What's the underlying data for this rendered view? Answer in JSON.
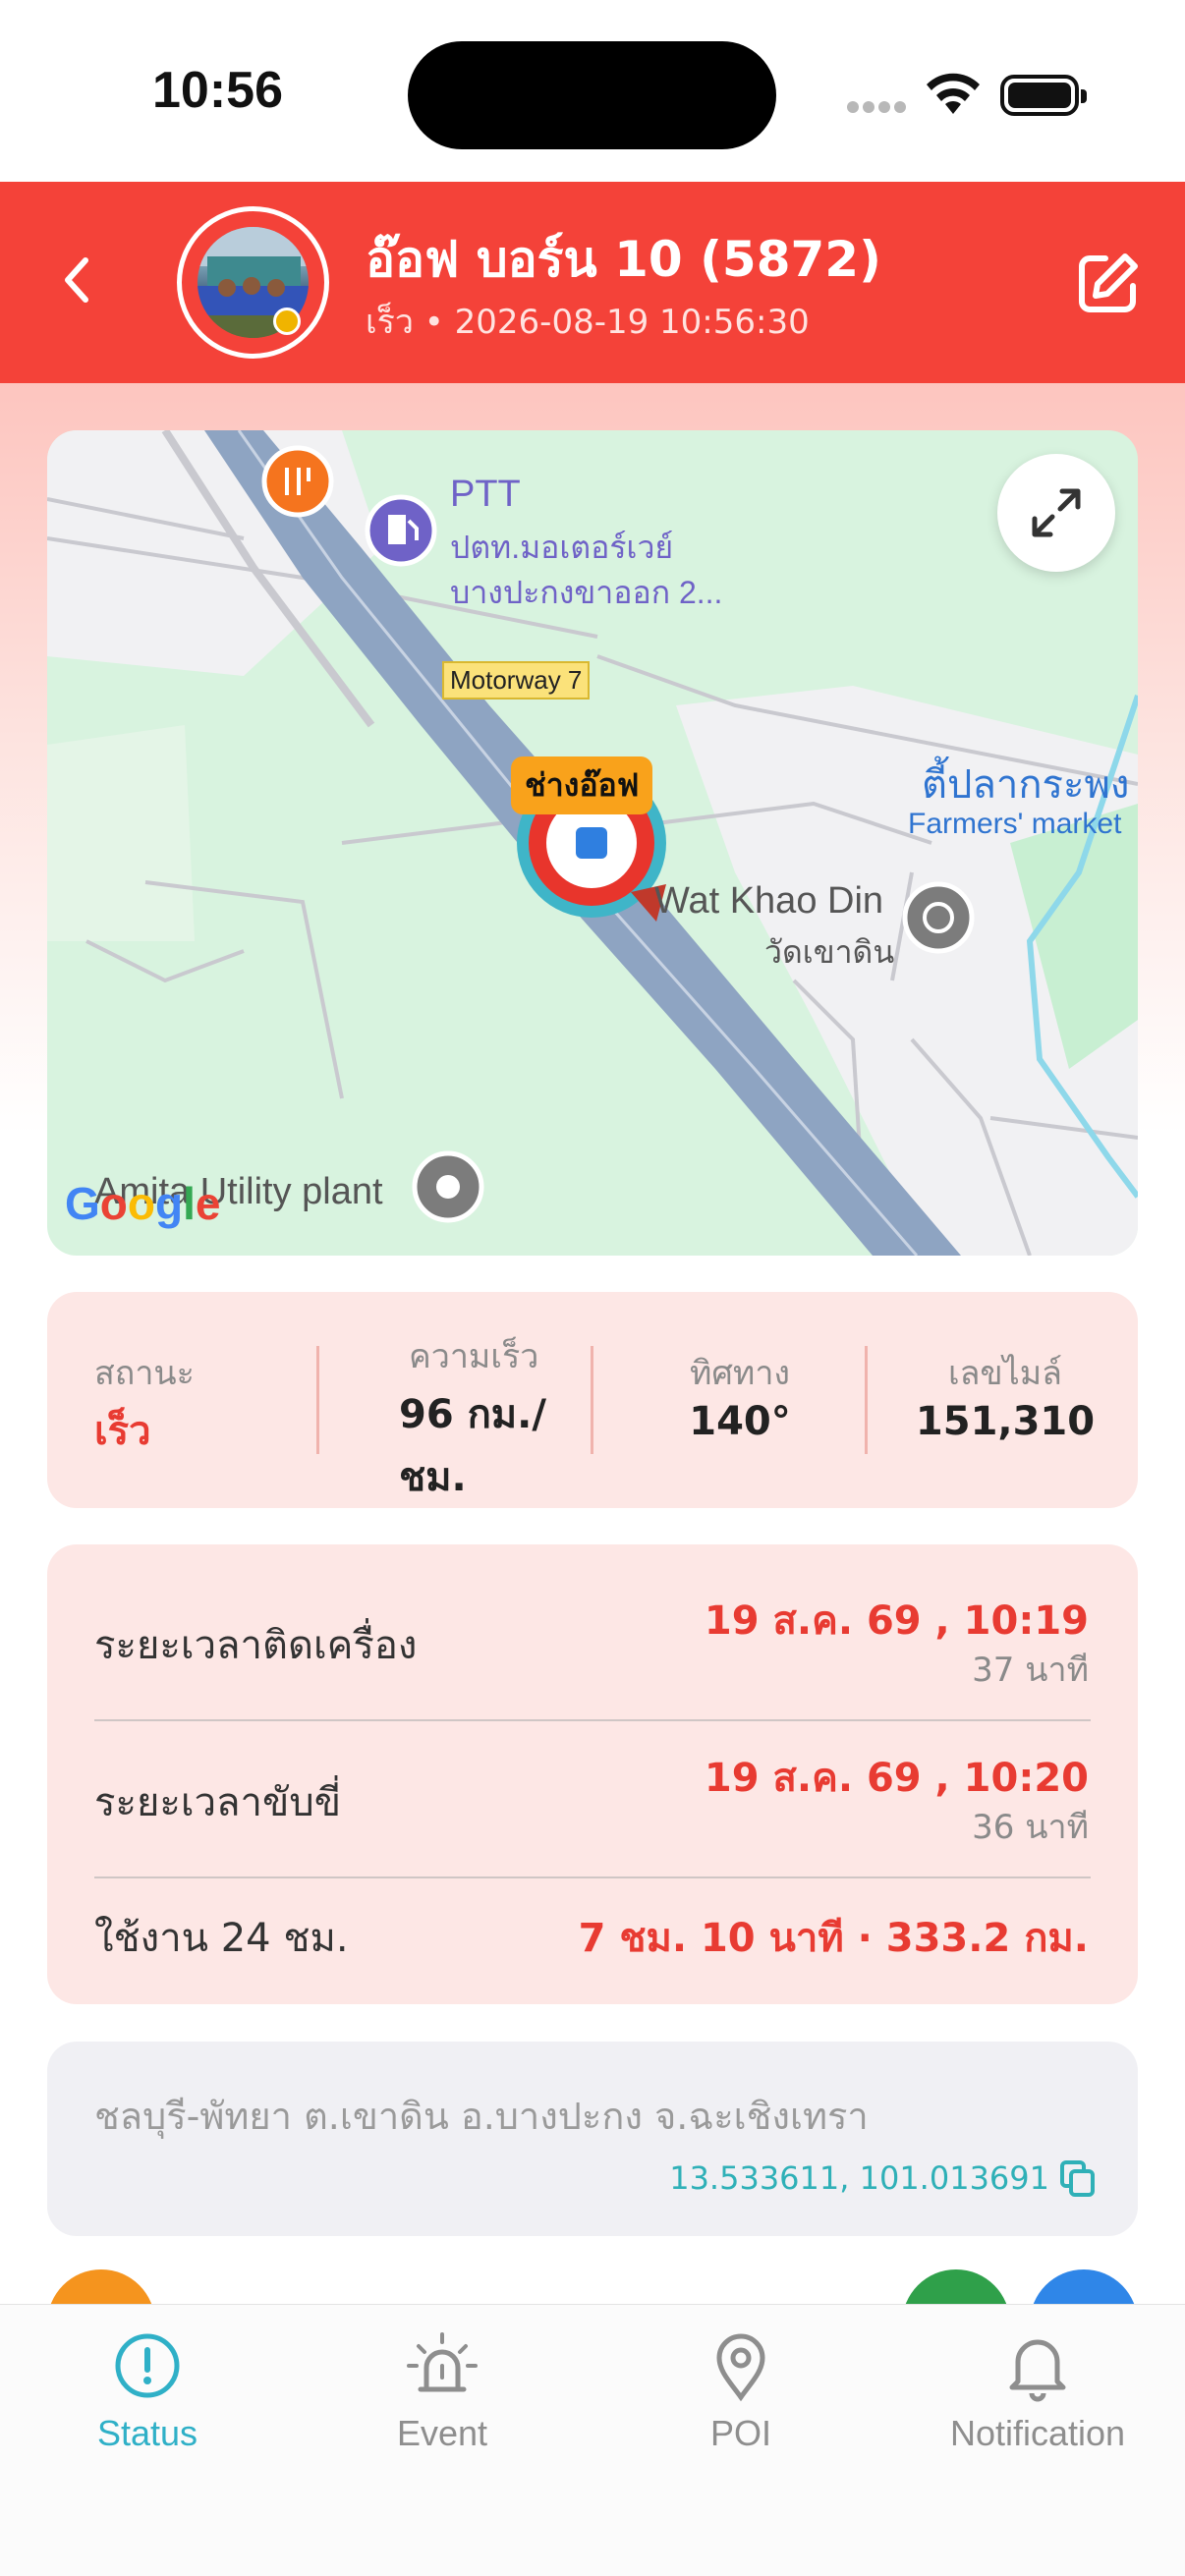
{
  "status_bar": {
    "time": "10:56"
  },
  "header": {
    "title": "อ๊อฟ บอร์น 10 (5872)",
    "subtitle": "เร็ว • 2026-08-19 10:56:30",
    "accent_color": "#f44239"
  },
  "map": {
    "poi_ptt_title": "PTT",
    "poi_ptt_line1": "ปตท.มอเตอร์เวย์",
    "poi_ptt_line2": "บางปะกงขาออก 2...",
    "road_label": "Motorway 7",
    "vehicle_label": "ช่างอ๊อฟ",
    "market_th": "ตี้ปลากระพง",
    "market_en": "Farmers' market",
    "temple_en": "Wat Khao Din",
    "temple_th": "วัดเขาดิน",
    "utility": "Amita Utility plant",
    "provider": "Google"
  },
  "stats": {
    "status_label": "สถานะ",
    "status_value": "เร็ว",
    "speed_label": "ความเร็ว",
    "speed_value_line1": "96 กม./",
    "speed_value_line2": "ชม.",
    "direction_label": "ทิศทาง",
    "direction_value": "140°",
    "odometer_label": "เลขไมล์",
    "odometer_value": "151,310"
  },
  "times": {
    "engine_label": "ระยะเวลาติดเครื่อง",
    "engine_value": "19 ส.ค. 69 , 10:19",
    "engine_sub": "37 นาที",
    "drive_label": "ระยะเวลาขับขี่",
    "drive_value": "19 ส.ค. 69 , 10:20",
    "drive_sub": "36 นาที",
    "usage_label": "ใช้งาน 24 ชม.",
    "usage_value": "7 ชม. 10 นาที · 333.2 กม."
  },
  "address": {
    "text": "ชลบุรี-พัทยา ต.เขาดิน อ.บางปะกง จ.ฉะเชิงเทรา",
    "coords": "13.533611, 101.013691"
  },
  "tabs": [
    {
      "label": "Status",
      "icon": "alert-circle-icon",
      "active": true
    },
    {
      "label": "Event",
      "icon": "siren-icon",
      "active": false
    },
    {
      "label": "POI",
      "icon": "map-pin-icon",
      "active": false
    },
    {
      "label": "Notification",
      "icon": "bell-icon",
      "active": false
    }
  ]
}
